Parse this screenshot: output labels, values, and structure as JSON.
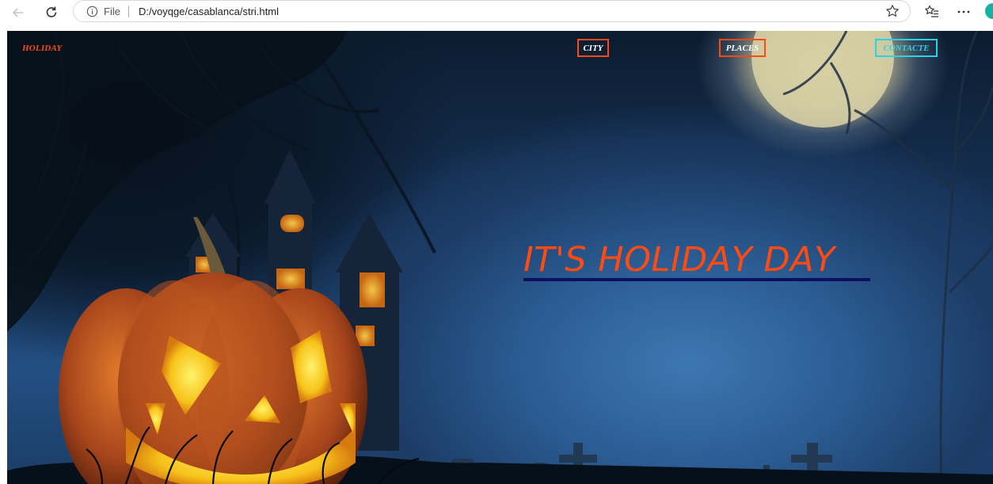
{
  "browser": {
    "scheme_label": "File",
    "url": "D:/voyqge/casablanca/stri.html"
  },
  "page": {
    "brand": "HOLIDAY",
    "nav": [
      {
        "label": "CITY"
      },
      {
        "label": "PLACES"
      },
      {
        "label": "CONTACTE"
      }
    ],
    "hero_title": "IT'S HOLIDAY DAY"
  },
  "colors": {
    "accent": "#ff4a12",
    "active_nav": "#26d4e8",
    "underline": "#0b1060"
  }
}
